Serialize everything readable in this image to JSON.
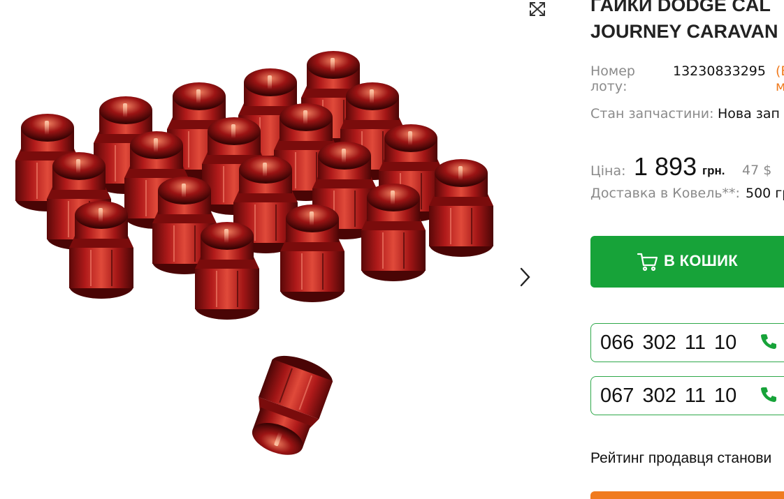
{
  "listing": {
    "title_line1": "ГАЙКИ DODGE CAL",
    "title_line2": "JOURNEY CARAVAN",
    "lot_label": "Номер лоту:",
    "lot_number": "13230833295",
    "lot_extra": "(В",
    "lot_extra2": "м",
    "condition_label": "Стан запчастини:",
    "condition_value": "Нова зап"
  },
  "price": {
    "label": "Ціна:",
    "value": "1 893",
    "currency": "грн.",
    "usd": "47 $",
    "delivery_label": "Доставка в Ковель**:",
    "delivery_value": "500 гр"
  },
  "actions": {
    "cart_label": "В КОШИК",
    "phone1": "066 302  11  10",
    "phone2": "067 302  11  10"
  },
  "seller": {
    "rating_text": "Рейтинг продавця станови"
  },
  "colors": {
    "accent_green": "#17a339",
    "accent_orange": "#f07b1f",
    "nut_red": "#a01818"
  },
  "icons": {
    "expand": "expand-icon",
    "next": "chevron-right-icon",
    "cart": "cart-icon",
    "phone": "phone-icon"
  }
}
